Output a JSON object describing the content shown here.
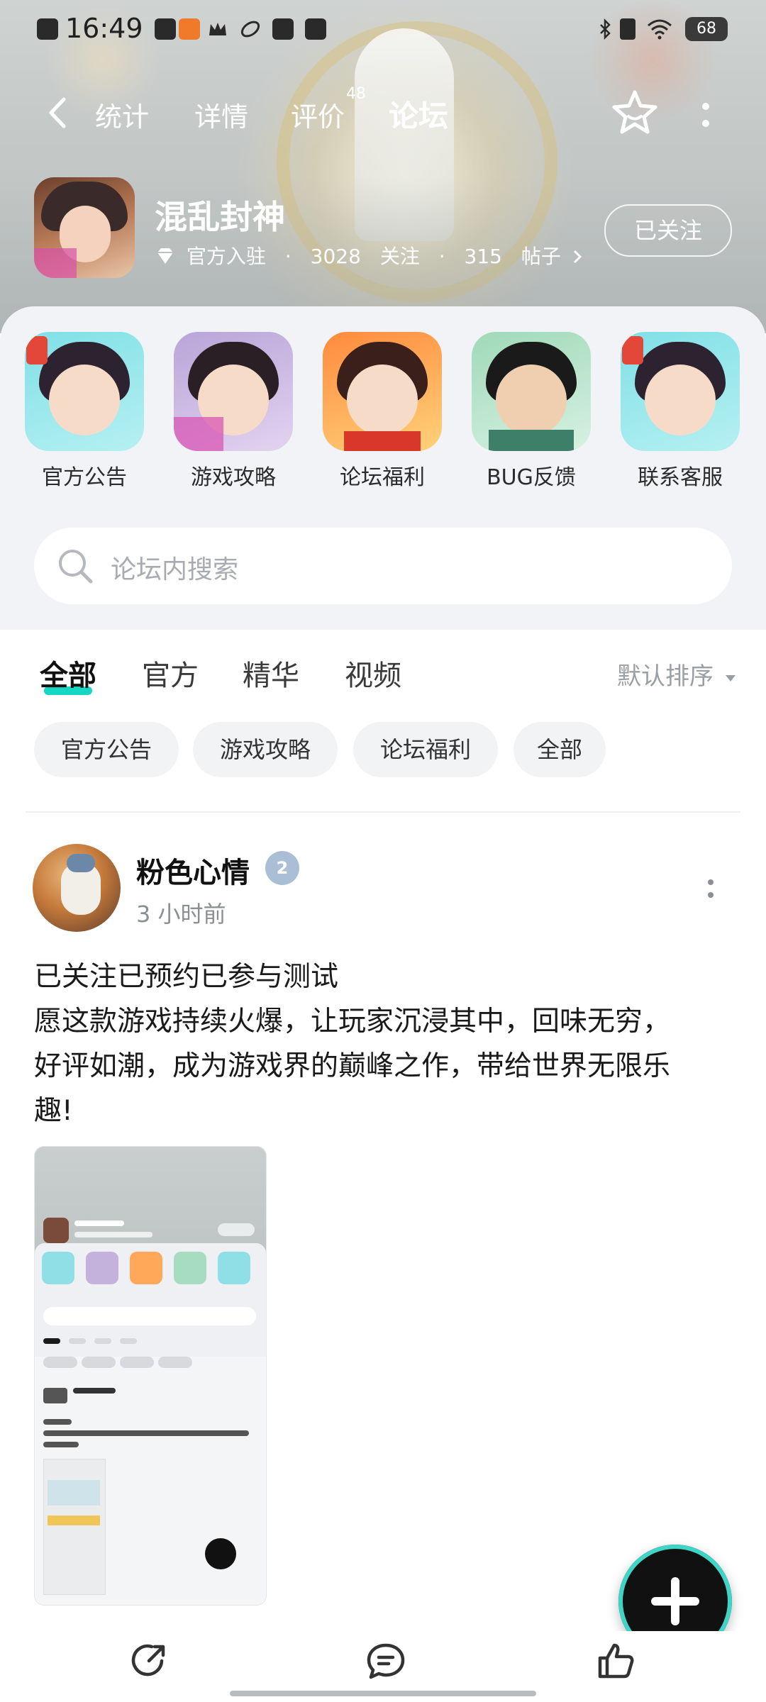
{
  "status_bar": {
    "time": "16:49",
    "battery": "68"
  },
  "nav": {
    "tabs": [
      {
        "label": "统计"
      },
      {
        "label": "详情"
      },
      {
        "label": "评价"
      },
      {
        "label": "论坛"
      }
    ],
    "review_count": "48",
    "active_tab": "论坛"
  },
  "game": {
    "title": "混乱封神",
    "official": "官方入驻",
    "followers": "3028",
    "followers_label": "关注",
    "posts": "315",
    "posts_label": "帖子",
    "follow_button": "已关注"
  },
  "categories": [
    {
      "label": "官方公告"
    },
    {
      "label": "游戏攻略"
    },
    {
      "label": "论坛福利"
    },
    {
      "label": "BUG反馈"
    },
    {
      "label": "联系客服"
    }
  ],
  "search": {
    "placeholder": "论坛内搜索"
  },
  "filter_tabs": [
    {
      "label": "全部"
    },
    {
      "label": "官方"
    },
    {
      "label": "精华"
    },
    {
      "label": "视频"
    }
  ],
  "sort_label": "默认排序",
  "chips": [
    {
      "label": "官方公告"
    },
    {
      "label": "游戏攻略"
    },
    {
      "label": "论坛福利"
    },
    {
      "label": "全部"
    }
  ],
  "post": {
    "author": "粉色心情",
    "level_badge": "2",
    "time_ago": "3 小时前",
    "body_lines": [
      "已关注已预约已参与测试",
      "愿这款游戏持续火爆，让玩家沉浸其中，回味无穷，",
      "好评如潮，成为游戏界的巅峰之作，带给世界无限乐",
      "趣!"
    ]
  },
  "colors": {
    "accent": "#15d7c3",
    "text_primary": "#1a1a1a",
    "text_secondary": "#8a8e95"
  }
}
